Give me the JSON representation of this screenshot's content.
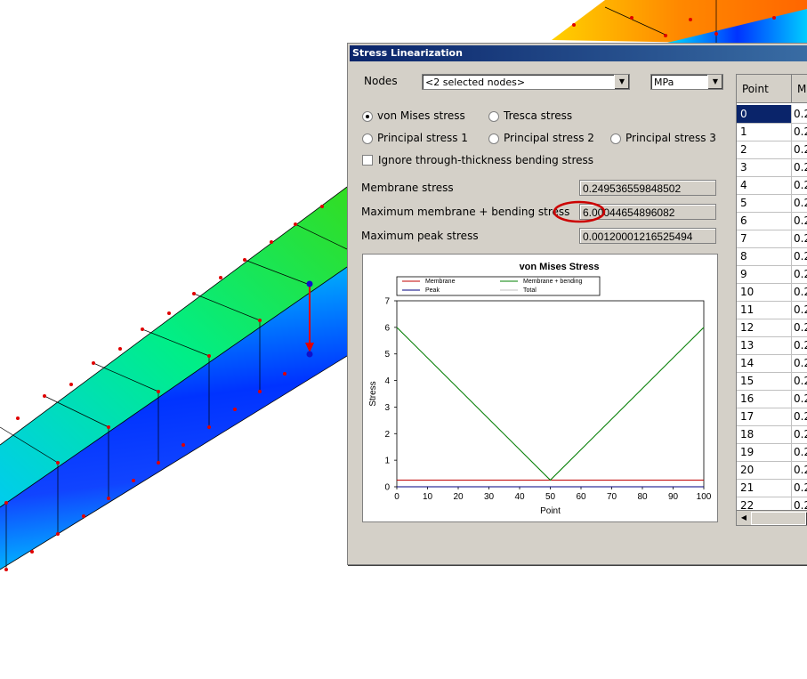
{
  "dialog": {
    "title": "Stress Linearization",
    "nodes_label": "Nodes",
    "nodes_value": "<2 selected nodes>",
    "units_value": "MPa",
    "options": {
      "von_mises": "von Mises stress",
      "tresca": "Tresca stress",
      "principal1": "Principal stress 1",
      "principal2": "Principal stress 2",
      "principal3": "Principal stress 3",
      "selected": "von_mises"
    },
    "ignore_bending_label": "Ignore through-thickness bending stress",
    "ignore_bending_checked": false,
    "membrane_label": "Membrane stress",
    "membrane_value": "0.249536559848502",
    "max_mb_label": "Maximum membrane + bending stress",
    "max_mb_value": "6.00044654896082",
    "max_peak_label": "Maximum peak stress",
    "max_peak_value": "0.00120001216525494"
  },
  "table": {
    "headers": [
      "Point",
      "Me"
    ],
    "rows": [
      [
        "0",
        "0.2"
      ],
      [
        "1",
        "0.2"
      ],
      [
        "2",
        "0.2"
      ],
      [
        "3",
        "0.2"
      ],
      [
        "4",
        "0.2"
      ],
      [
        "5",
        "0.2"
      ],
      [
        "6",
        "0.2"
      ],
      [
        "7",
        "0.2"
      ],
      [
        "8",
        "0.2"
      ],
      [
        "9",
        "0.2"
      ],
      [
        "10",
        "0.2"
      ],
      [
        "11",
        "0.2"
      ],
      [
        "12",
        "0.2"
      ],
      [
        "13",
        "0.2"
      ],
      [
        "14",
        "0.2"
      ],
      [
        "15",
        "0.2"
      ],
      [
        "16",
        "0.2"
      ],
      [
        "17",
        "0.2"
      ],
      [
        "18",
        "0.2"
      ],
      [
        "19",
        "0.2"
      ],
      [
        "20",
        "0.2"
      ],
      [
        "21",
        "0.2"
      ],
      [
        "22",
        "0.2"
      ]
    ],
    "selected_row": 0
  },
  "chart_data": {
    "type": "line",
    "title": "von Mises Stress",
    "xlabel": "Point",
    "ylabel": "Stress",
    "xlim": [
      0,
      100
    ],
    "ylim": [
      0,
      7
    ],
    "xticks": [
      0,
      10,
      20,
      30,
      40,
      50,
      60,
      70,
      80,
      90,
      100
    ],
    "yticks": [
      0,
      1,
      2,
      3,
      4,
      5,
      6,
      7
    ],
    "legend_placement": "top",
    "series": [
      {
        "name": "Membrane",
        "color": "#c00000",
        "x": [
          0,
          100
        ],
        "y": [
          0.25,
          0.25
        ]
      },
      {
        "name": "Membrane + bending",
        "color": "#008000",
        "x": [
          0,
          50,
          100
        ],
        "y": [
          6.0,
          0.25,
          6.0
        ]
      },
      {
        "name": "Peak",
        "color": "#000080",
        "x": [
          0,
          100
        ],
        "y": [
          0.0012,
          0.0012
        ]
      },
      {
        "name": "Total",
        "color": "#c0c0c0",
        "x": [
          0,
          50,
          100
        ],
        "y": [
          6.0,
          0.25,
          6.0
        ]
      }
    ]
  },
  "colors": {
    "highlight_ellipse": "#cc0000",
    "titlebar": "#0a246a",
    "dialog_bg": "#d4d0c8"
  }
}
